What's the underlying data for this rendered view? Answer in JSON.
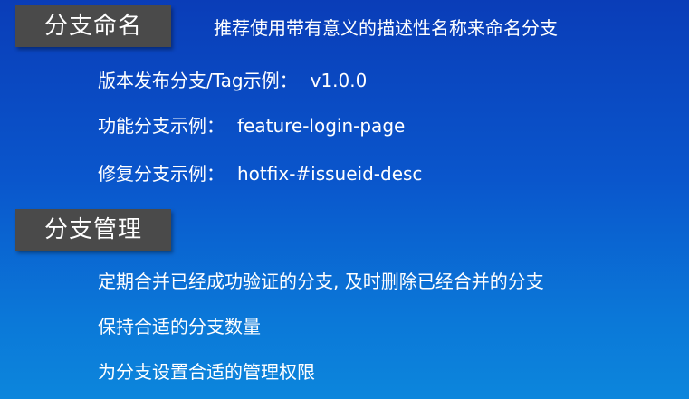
{
  "naming": {
    "label": "分支命名",
    "subtitle": "推荐使用带有意义的描述性名称来命名分支",
    "examples": [
      {
        "label": "版本发布分支/Tag示例：",
        "value": "v1.0.0"
      },
      {
        "label": "功能分支示例：",
        "value": "feature-login-page"
      },
      {
        "label": "修复分支示例：",
        "value": "hotfix-#issueid-desc"
      }
    ]
  },
  "management": {
    "label": "分支管理",
    "items": [
      "定期合并已经成功验证的分支, 及时删除已经合并的分支",
      "保持合适的分支数量",
      "为分支设置合适的管理权限"
    ]
  },
  "colors": {
    "background_top": "#0a3db8",
    "background_bottom": "#0c86dc",
    "label_box": "#4a4a4a",
    "text": "#ffffff"
  }
}
